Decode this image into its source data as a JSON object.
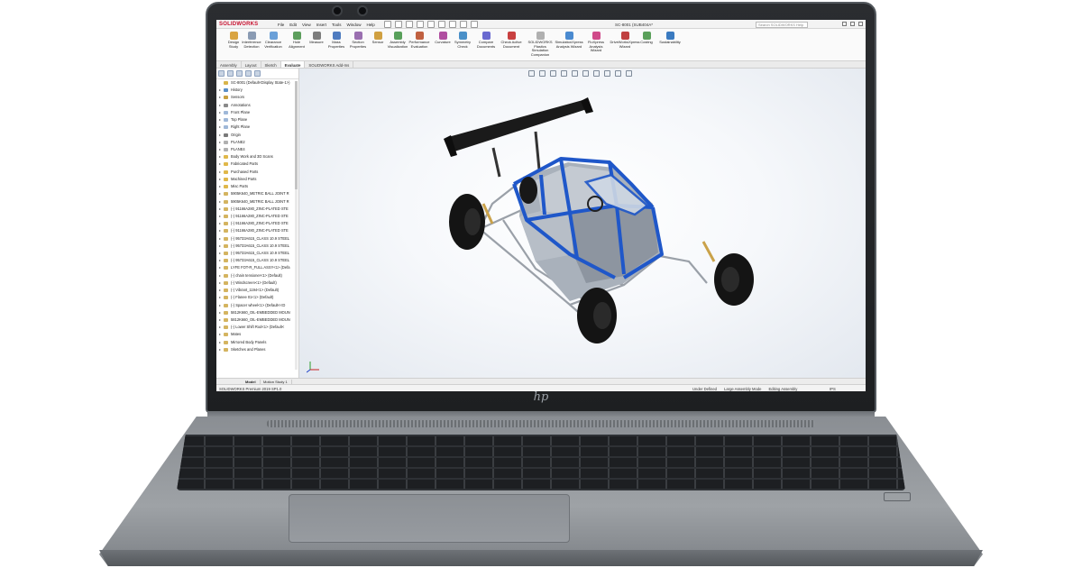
{
  "app": {
    "logo_text": "SOLIDWORKS",
    "menu": [
      "File",
      "Edit",
      "View",
      "Insert",
      "Tools",
      "Window",
      "Help"
    ],
    "document_title": "SC-8001 (SUB404A*",
    "search_placeholder": "Search SOLIDWORKS Help",
    "brand_color": "#c8102e"
  },
  "ribbon": {
    "items": [
      {
        "label": "Design\nStudy",
        "icon": "design-study-icon",
        "color": "#d9a441"
      },
      {
        "label": "Interference\nDetection",
        "icon": "interference-icon",
        "color": "#8a9bb3"
      },
      {
        "label": "Clearance\nVerification",
        "icon": "clearance-icon",
        "color": "#6aa0d8"
      },
      {
        "label": "Hole\nAlignment",
        "icon": "hole-icon",
        "color": "#5c9e5c"
      },
      {
        "label": "Measure",
        "icon": "measure-icon",
        "color": "#7d7d7d"
      },
      {
        "label": "Mass\nProperties",
        "icon": "mass-icon",
        "color": "#4f7cc0"
      },
      {
        "label": "Section\nProperties",
        "icon": "section-icon",
        "color": "#9a6fb0"
      },
      {
        "label": "Sensor",
        "icon": "sensor-icon",
        "color": "#d0a040"
      },
      {
        "label": "Assembly\nVisualization",
        "icon": "assembly-vis-icon",
        "color": "#58a05a"
      },
      {
        "label": "Performance\nEvaluation",
        "icon": "performance-icon",
        "color": "#c06040"
      },
      {
        "label": "Curvature",
        "icon": "curvature-icon",
        "color": "#b04ea0"
      },
      {
        "label": "Symmetry\nCheck",
        "icon": "symmetry-icon",
        "color": "#4a90c8"
      },
      {
        "label": "Compare\nDocuments",
        "icon": "compare-icon",
        "color": "#6a6ad0"
      },
      {
        "label": "Check Active\nDocument",
        "icon": "check-icon",
        "color": "#c84040"
      },
      {
        "label": "SOLIDWORKS Plastics\nSimulation\nCompanion",
        "icon": "plastics-icon",
        "color": "#b0b0b0"
      },
      {
        "label": "SimulationXpress\nAnalysis Wizard",
        "icon": "simxpress-icon",
        "color": "#4a8ad0"
      },
      {
        "label": "FloXpress\nAnalysis\nWizard",
        "icon": "floxpress-icon",
        "color": "#d04a8a"
      },
      {
        "label": "DriveWorksXpress\nWizard",
        "icon": "driveworks-icon",
        "color": "#c04040"
      },
      {
        "label": "Costing",
        "icon": "costing-icon",
        "color": "#5aa05a"
      },
      {
        "label": "Sustainability",
        "icon": "sustainability-icon",
        "color": "#3a7ac0"
      }
    ]
  },
  "tabs": [
    "Assembly",
    "Layout",
    "Sketch",
    "Evaluate",
    "SOLIDWORKS Add-Ins"
  ],
  "active_tab": "Evaluate",
  "tree": {
    "root": "SC-8001 (Default<Display State-1>)",
    "items": [
      "History",
      "Sensors",
      "Annotations",
      "Front Plane",
      "Top Plane",
      "Right Plane",
      "Origin",
      "PLANE2",
      "PLANE4",
      "Body Work and 3D Scans",
      "Fabricated Parts",
      "Purchased Parts",
      "Machined Parts",
      "Misc Parts",
      "5905K640_METRIC BALL JOINT R",
      "5905K640_METRIC BALL JOINT R",
      "(-) 91166A280_ZINC-PLATED STE",
      "(-) 91166A280_ZINC-PLATED STE",
      "(-) 91166A280_ZINC-PLATED STE",
      "(-) 91166A280_ZINC-PLATED STE",
      "(-) 95733A615_CLASS 10.9 STEEL",
      "(-) 95733A615_CLASS 10.9 STEEL",
      "(-) 95733A615_CLASS 10.9 STEEL",
      "(-) 95733A615_CLASS 10.9 STEEL",
      "LYFE FOT-R_FULL ASSY<1> (Defa",
      "(-) chain tensioner<1> (Default)",
      "(-) Windscreen<1> (Default)",
      "(-) Vibrant_1194<1> (Default)",
      "(-) Flanee 01<1> (Default)",
      "(-) Spacer wheel<1> (Default<<D",
      "5812K660_OIL-EMBEDDED MOUN",
      "5812K660_OIL-EMBEDDED MOUN",
      "(-) Lower Shift Rod<1> (Default<",
      "Mates",
      "Mirrored Body Panels",
      "Sketches and Planes"
    ]
  },
  "bottom_tabs": [
    "Model",
    "Motion Study 1"
  ],
  "status": {
    "left": "SOLIDWORKS Premium 2019 SP1.0",
    "right": [
      "Under Defined",
      "Large Assembly Mode",
      "Editing Assembly"
    ],
    "units": "IPS"
  },
  "laptop": {
    "brand": "hp"
  },
  "model": {
    "body_color": "#1f57c9",
    "wing_color": "#1a1a1a"
  }
}
